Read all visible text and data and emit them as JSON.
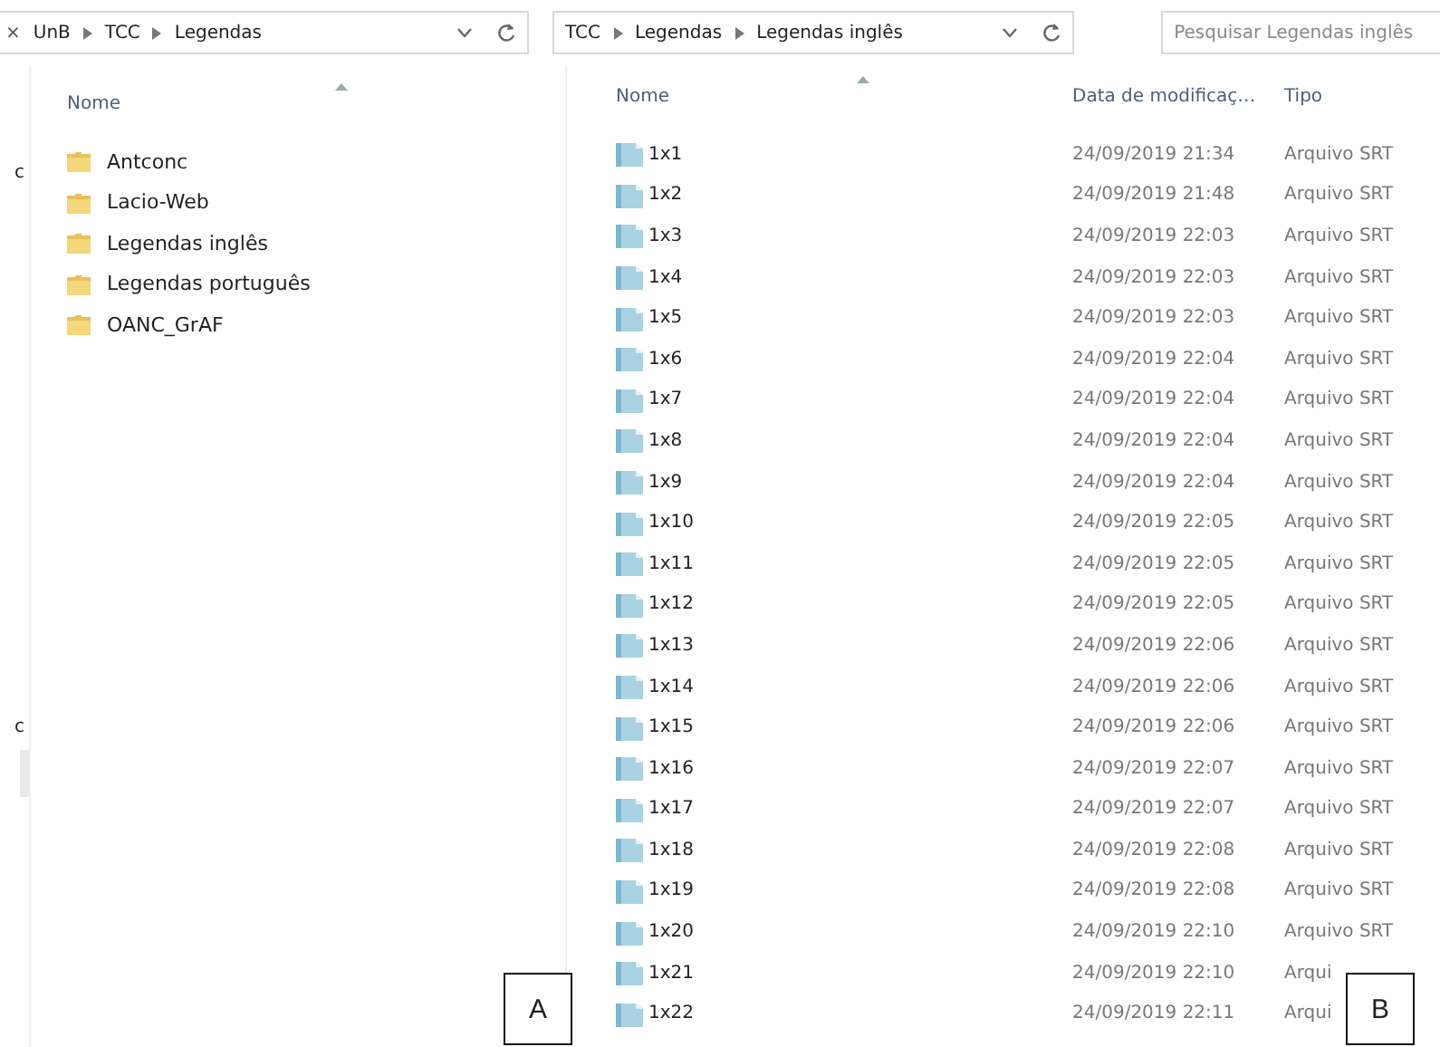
{
  "left_window": {
    "breadcrumb_fragment": "×",
    "breadcrumb": [
      "UnB",
      "TCC",
      "Legendas"
    ],
    "column_header": "Nome",
    "nav_fragments": [
      "c",
      "c"
    ],
    "folders": [
      {
        "name": "Antconc"
      },
      {
        "name": "Lacio-Web"
      },
      {
        "name": "Legendas inglês"
      },
      {
        "name": "Legendas português"
      },
      {
        "name": "OANC_GrAF"
      }
    ]
  },
  "right_window": {
    "breadcrumb": [
      "TCC",
      "Legendas",
      "Legendas inglês"
    ],
    "search": {
      "placeholder": "Pesquisar Legendas inglês"
    },
    "columns": [
      "Nome",
      "Data de modificaç…",
      "Tipo"
    ],
    "files": [
      {
        "name": "1x1",
        "modified": "24/09/2019 21:34",
        "type": "Arquivo SRT"
      },
      {
        "name": "1x2",
        "modified": "24/09/2019 21:48",
        "type": "Arquivo SRT"
      },
      {
        "name": "1x3",
        "modified": "24/09/2019 22:03",
        "type": "Arquivo SRT"
      },
      {
        "name": "1x4",
        "modified": "24/09/2019 22:03",
        "type": "Arquivo SRT"
      },
      {
        "name": "1x5",
        "modified": "24/09/2019 22:03",
        "type": "Arquivo SRT"
      },
      {
        "name": "1x6",
        "modified": "24/09/2019 22:04",
        "type": "Arquivo SRT"
      },
      {
        "name": "1x7",
        "modified": "24/09/2019 22:04",
        "type": "Arquivo SRT"
      },
      {
        "name": "1x8",
        "modified": "24/09/2019 22:04",
        "type": "Arquivo SRT"
      },
      {
        "name": "1x9",
        "modified": "24/09/2019 22:04",
        "type": "Arquivo SRT"
      },
      {
        "name": "1x10",
        "modified": "24/09/2019 22:05",
        "type": "Arquivo SRT"
      },
      {
        "name": "1x11",
        "modified": "24/09/2019 22:05",
        "type": "Arquivo SRT"
      },
      {
        "name": "1x12",
        "modified": "24/09/2019 22:05",
        "type": "Arquivo SRT"
      },
      {
        "name": "1x13",
        "modified": "24/09/2019 22:06",
        "type": "Arquivo SRT"
      },
      {
        "name": "1x14",
        "modified": "24/09/2019 22:06",
        "type": "Arquivo SRT"
      },
      {
        "name": "1x15",
        "modified": "24/09/2019 22:06",
        "type": "Arquivo SRT"
      },
      {
        "name": "1x16",
        "modified": "24/09/2019 22:07",
        "type": "Arquivo SRT"
      },
      {
        "name": "1x17",
        "modified": "24/09/2019 22:07",
        "type": "Arquivo SRT"
      },
      {
        "name": "1x18",
        "modified": "24/09/2019 22:08",
        "type": "Arquivo SRT"
      },
      {
        "name": "1x19",
        "modified": "24/09/2019 22:08",
        "type": "Arquivo SRT"
      },
      {
        "name": "1x20",
        "modified": "24/09/2019 22:10",
        "type": "Arquivo SRT"
      },
      {
        "name": "1x21",
        "modified": "24/09/2019 22:10",
        "type": "Arqui"
      },
      {
        "name": "1x22",
        "modified": "24/09/2019 22:11",
        "type": "Arqui"
      }
    ]
  },
  "labels": [
    "A",
    "B"
  ]
}
